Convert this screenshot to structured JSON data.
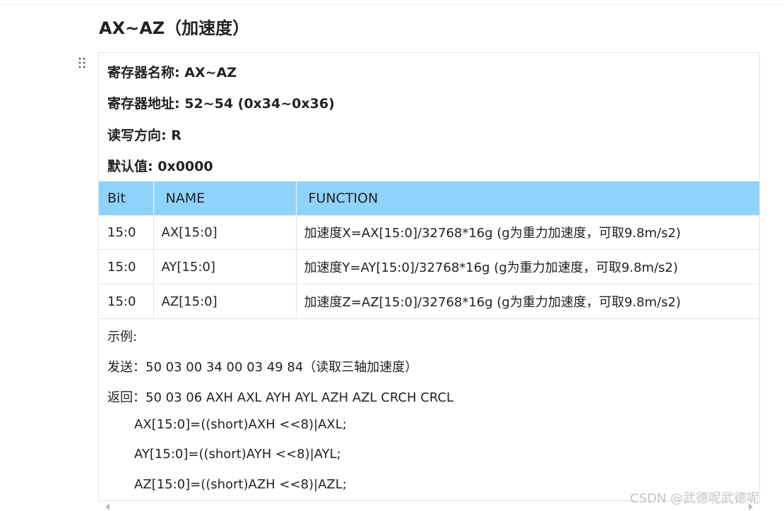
{
  "heading": "AX~AZ（加速度）",
  "properties": [
    {
      "key": "寄存器名称:",
      "value": "AX~AZ"
    },
    {
      "key": "寄存器地址:",
      "value": "52~54 (0x34~0x36)"
    },
    {
      "key": "读写方向:",
      "value": "R"
    },
    {
      "key": "默认值:",
      "value": "0x0000"
    }
  ],
  "table": {
    "headers": [
      "Bit",
      "NAME",
      "FUNCTION"
    ],
    "rows": [
      [
        "15:0",
        "AX[15:0]",
        "加速度X=AX[15:0]/32768*16g (g为重力加速度，可取9.8m/s2)"
      ],
      [
        "15:0",
        "AY[15:0]",
        "加速度Y=AY[15:0]/32768*16g (g为重力加速度，可取9.8m/s2)"
      ],
      [
        "15:0",
        "AZ[15:0]",
        "加速度Z=AZ[15:0]/32768*16g (g为重力加速度，可取9.8m/s2)"
      ]
    ],
    "header_color": "#8fd3fb"
  },
  "example": {
    "title": "示例:",
    "send": "发送：50 03 00 34 00 03 49 84（读取三轴加速度）",
    "reply": "返回：50 03 06 AXH AXL AYH AYL AZH AZL CRCH CRCL",
    "formulas": [
      "AX[15:0]=((short)AXH <<8)|AXL;",
      "AY[15:0]=((short)AYH <<8)|AYL;",
      "AZ[15:0]=((short)AZH <<8)|AZL;"
    ]
  },
  "watermark": "CSDN @武德呢武德呢",
  "icons": {
    "drag_handle": "drag-handle-icon",
    "scroll_left": "chevron-left-icon",
    "scroll_right": "chevron-right-icon"
  }
}
